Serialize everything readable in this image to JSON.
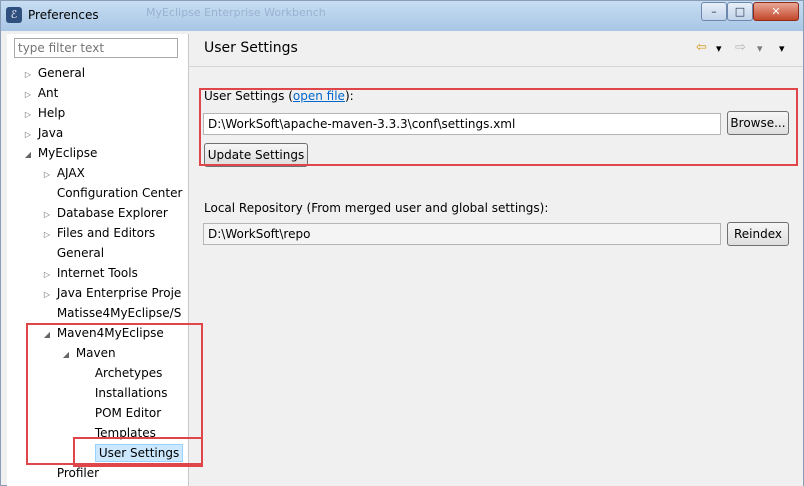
{
  "window": {
    "title": "Preferences",
    "ghost_title": "MyEclipse Enterprise Workbench",
    "minimize": "–",
    "maximize": "□",
    "close": "✕"
  },
  "filter": {
    "placeholder": "type filter text"
  },
  "tree": [
    {
      "label": "General",
      "arrow": "▷"
    },
    {
      "label": "Ant",
      "arrow": "▷"
    },
    {
      "label": "Help",
      "arrow": "▷"
    },
    {
      "label": "Java",
      "arrow": "▷"
    },
    {
      "label": "MyEclipse",
      "arrow": "◢"
    },
    {
      "label": "AJAX",
      "arrow": "▷"
    },
    {
      "label": "Configuration Center",
      "arrow": ""
    },
    {
      "label": "Database Explorer",
      "arrow": "▷"
    },
    {
      "label": "Files and Editors",
      "arrow": "▷"
    },
    {
      "label": "General",
      "arrow": ""
    },
    {
      "label": "Internet Tools",
      "arrow": "▷"
    },
    {
      "label": "Java Enterprise Proje",
      "arrow": "▷"
    },
    {
      "label": "Matisse4MyEclipse/S",
      "arrow": ""
    },
    {
      "label": "Maven4MyEclipse",
      "arrow": "◢"
    },
    {
      "label": "Maven",
      "arrow": "◢"
    },
    {
      "label": "Archetypes",
      "arrow": ""
    },
    {
      "label": "Installations",
      "arrow": ""
    },
    {
      "label": "POM Editor",
      "arrow": ""
    },
    {
      "label": "Templates",
      "arrow": ""
    },
    {
      "label": "User Settings",
      "arrow": ""
    },
    {
      "label": "Profiler",
      "arrow": ""
    }
  ],
  "page": {
    "title": "User Settings",
    "back_icon": "⇦",
    "forward_icon": "⇨",
    "dropdown_icon": "▾",
    "menu_icon": "▾",
    "user_settings_label": "User Settings (",
    "open_file_link": "open file",
    "user_settings_suffix": "):",
    "settings_path": "D:\\WorkSoft\\apache-maven-3.3.3\\conf\\settings.xml",
    "browse_button": "Browse...",
    "update_button": "Update Settings",
    "local_repo_label": "Local Repository (From merged user and global settings):",
    "repo_path": "D:\\WorkSoft\\repo",
    "reindex_button": "Reindex"
  }
}
